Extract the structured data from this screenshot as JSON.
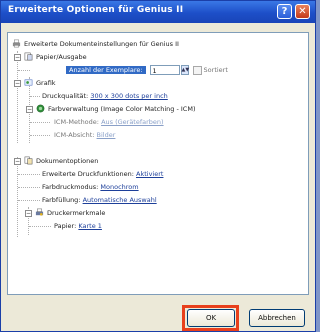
{
  "window": {
    "title": "Erweiterte Optionen für Genius II",
    "help_glyph": "?",
    "close_glyph": "✕"
  },
  "tree": {
    "root_label": "Erweiterte Dokumenteinstellungen für Genius II",
    "paper_output": {
      "label": "Papier/Ausgabe",
      "copies_label": "Anzahl der Exemplare:",
      "copies_value": "1",
      "collate_label": "Sortiert"
    },
    "graphics": {
      "label": "Grafik",
      "print_quality_label": "Druckqualität:",
      "print_quality_value": "300 x 300 dots per inch",
      "color_mgmt_label": "Farbverwaltung (Image Color Matching - ICM)",
      "icm_method_label": "ICM-Methode:",
      "icm_method_value": "Aus (Gerätefarben)",
      "icm_intent_label": "ICM-Absicht:",
      "icm_intent_value": "Bilder"
    },
    "doc_options": {
      "label": "Dokumentoptionen",
      "advanced_print_label": "Erweiterte Druckfunktionen:",
      "advanced_print_value": "Aktiviert",
      "color_print_mode_label": "Farbdruckmodus:",
      "color_print_mode_value": "Monochrom",
      "color_fill_label": "Farbfüllung:",
      "color_fill_value": "Automatische Auswahl",
      "printer_features_label": "Druckermerkmale",
      "paper_label": "Papier:",
      "paper_value": "Karte 1"
    }
  },
  "buttons": {
    "ok": "OK",
    "cancel": "Abbrechen"
  },
  "colors": {
    "titlebar": "#1d4fc8",
    "highlight": "#e8401c",
    "value_link": "#1d3f9a"
  }
}
